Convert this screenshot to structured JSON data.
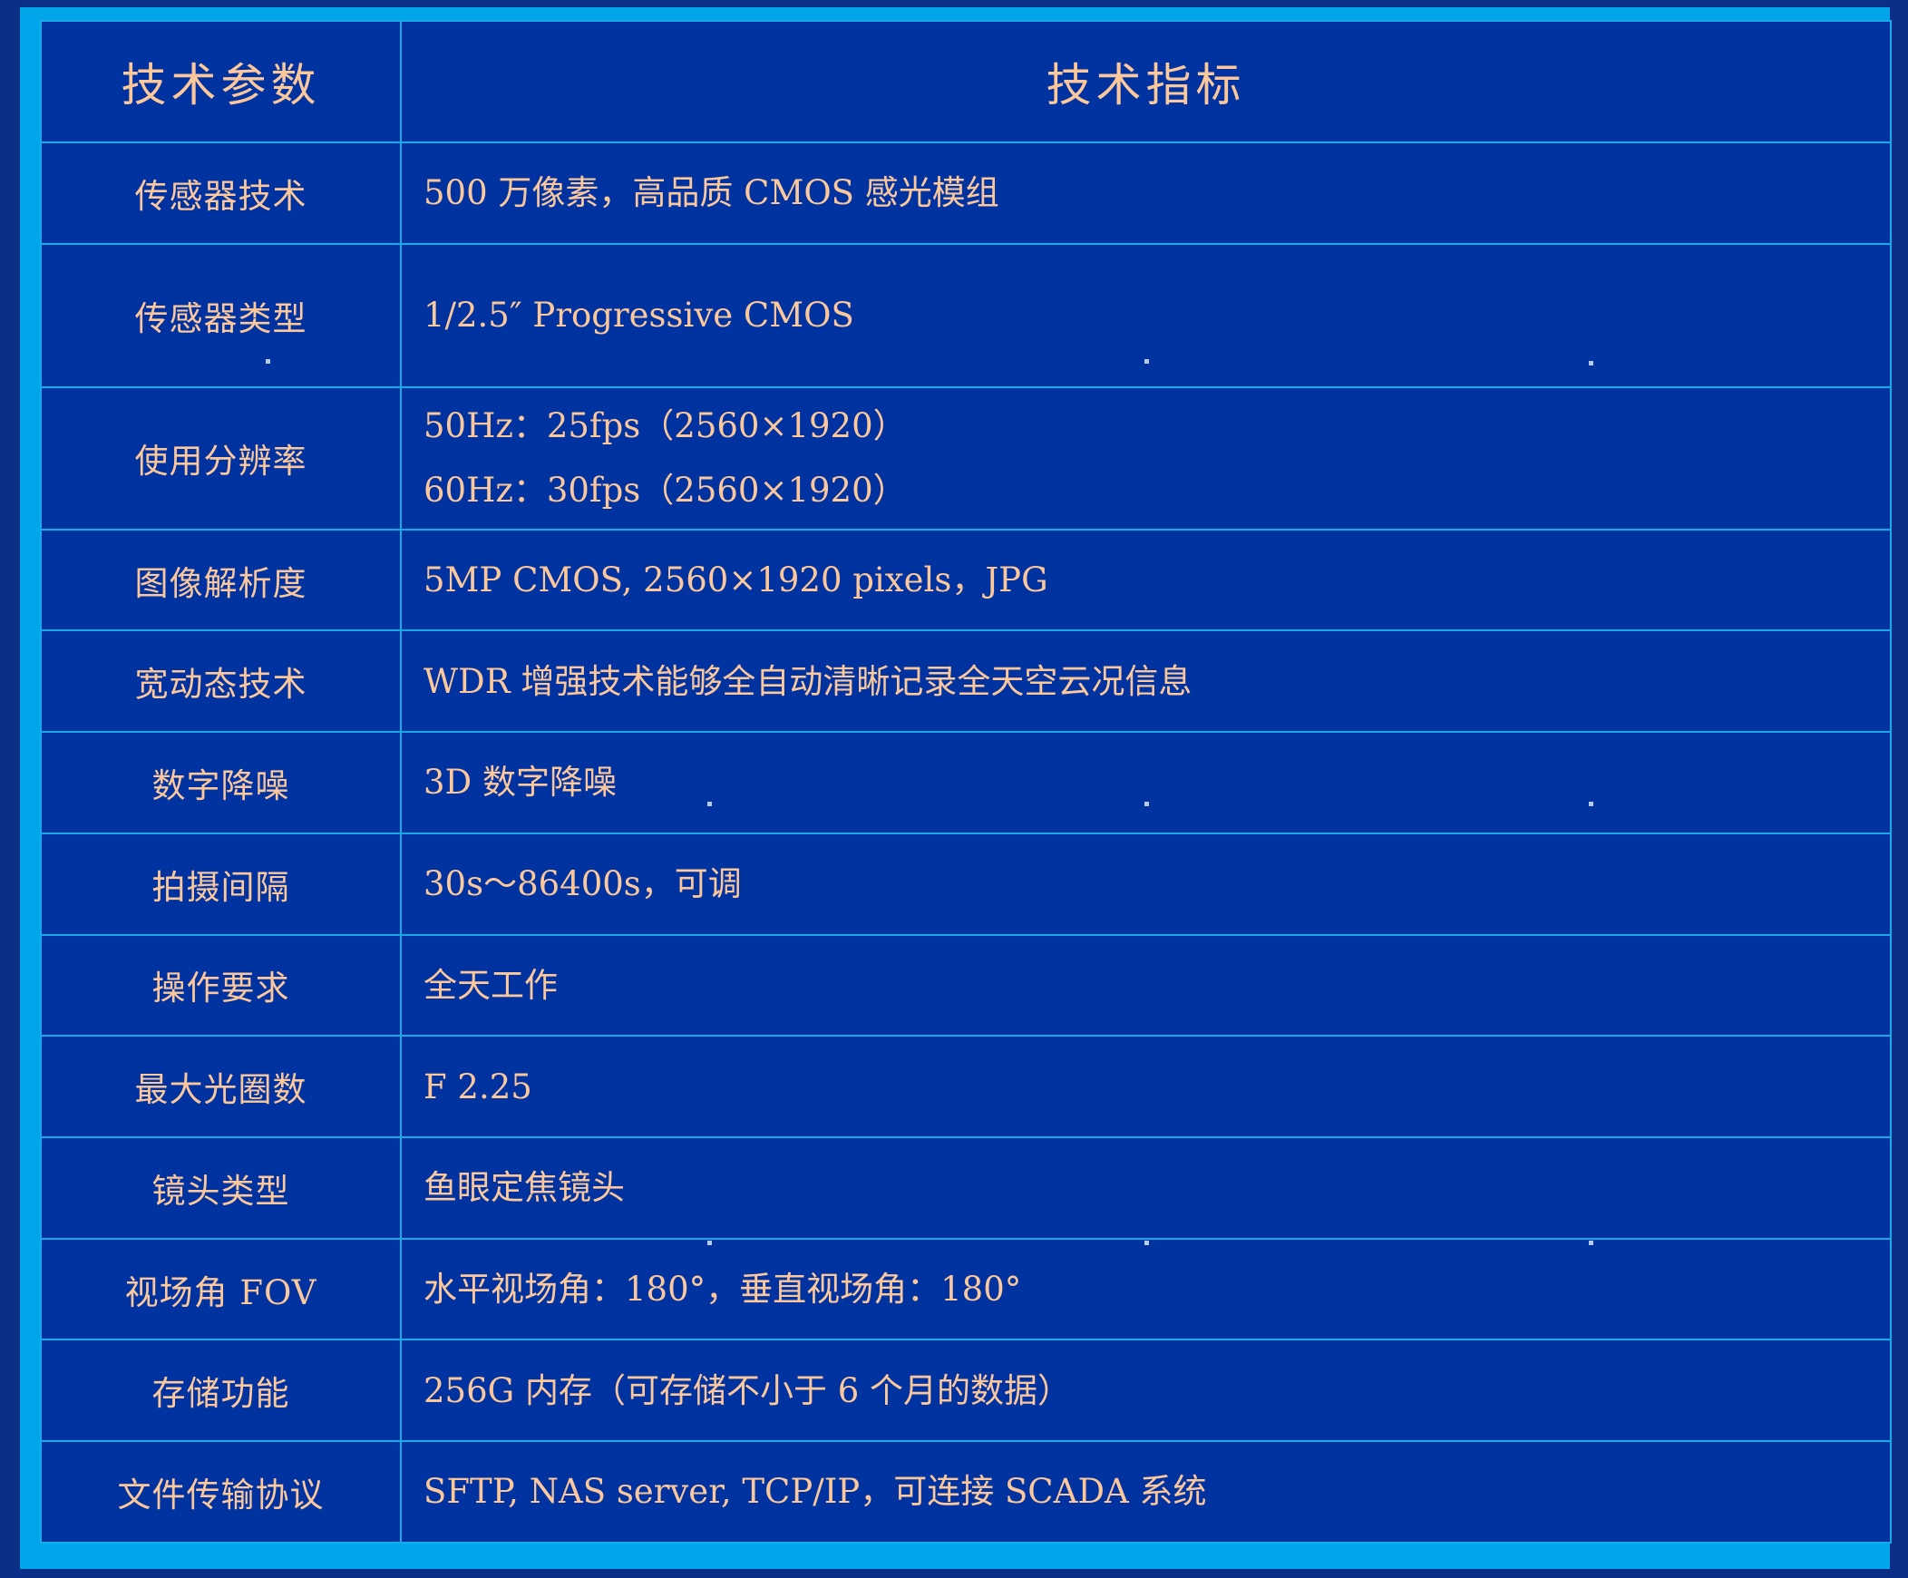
{
  "table": {
    "header": {
      "param_label": "技术参数",
      "value_label": "技术指标"
    },
    "rows": [
      {
        "param": "传感器技术",
        "value": "500 万像素，高品质 CMOS 感光模组"
      },
      {
        "param": "传感器类型",
        "value": "1/2.5″ Progressive CMOS"
      },
      {
        "param": "使用分辨率",
        "value_line1": "50Hz：25fps（2560×1920）",
        "value_line2": "60Hz：30fps（2560×1920）"
      },
      {
        "param": "图像解析度",
        "value": "5MP CMOS, 2560×1920 pixels，JPG"
      },
      {
        "param": "宽动态技术",
        "value": "WDR 增强技术能够全自动清晰记录全天空云况信息"
      },
      {
        "param": "数字降噪",
        "value": "3D 数字降噪"
      },
      {
        "param": "拍摄间隔",
        "value": "30s～86400s，可调"
      },
      {
        "param": "操作要求",
        "value": "全天工作"
      },
      {
        "param": "最大光圈数",
        "value": "F 2.25"
      },
      {
        "param": "镜头类型",
        "value": "鱼眼定焦镜头"
      },
      {
        "param": "视场角 FOV",
        "value": "水平视场角：180°，垂直视场角：180°"
      },
      {
        "param": "存储功能",
        "value": "256G 内存（可存储不小于 6 个月的数据）"
      },
      {
        "param": "文件传输协议",
        "value": "SFTP, NAS server, TCP/IP，可连接 SCADA 系统"
      }
    ]
  },
  "colors": {
    "background": "#0b2f86",
    "frame": "#00a6e9",
    "cell": "#0033a0",
    "gridline": "#17a9e8",
    "text": "#fcc89b"
  }
}
